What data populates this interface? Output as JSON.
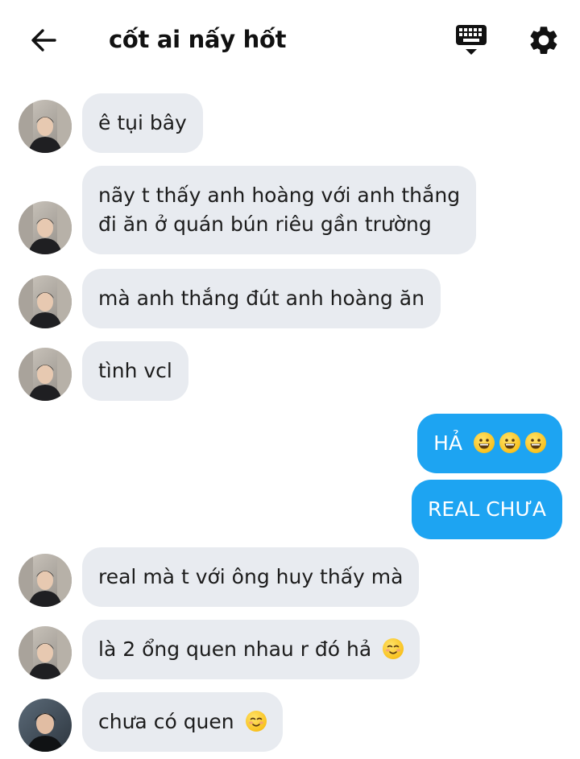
{
  "header": {
    "title": "cốt ai nấy hốt",
    "icons": [
      "back-arrow-icon",
      "keyboard-icon",
      "settings-gear-icon"
    ]
  },
  "messages": [
    {
      "sender": "other",
      "text": "ê tụi bây"
    },
    {
      "sender": "other",
      "lines": [
        "nãy t thấy anh hoàng với anh thắng",
        "đi ăn ở quán bún riêu gần trường"
      ]
    },
    {
      "sender": "other",
      "text": "mà anh thắng đút anh hoàng ăn"
    },
    {
      "sender": "other",
      "text": "tình vcl"
    },
    {
      "sender": "me",
      "text": "HẢ",
      "emoji": "grinning-face"
    },
    {
      "sender": "me",
      "text": "REAL CHƯA"
    },
    {
      "sender": "other",
      "text": "real mà t với ông huy thấy mà"
    },
    {
      "sender": "other",
      "text": "là 2 ổng quen nhau r đó hả",
      "emoji": "smiling-face"
    },
    {
      "sender": "other",
      "text": "chưa có quen",
      "emoji": "smiling-face"
    }
  ],
  "colors": {
    "incoming_bubble": "#e8ebf0",
    "outgoing_bubble": "#1da4f2",
    "background": "#ffffff"
  }
}
